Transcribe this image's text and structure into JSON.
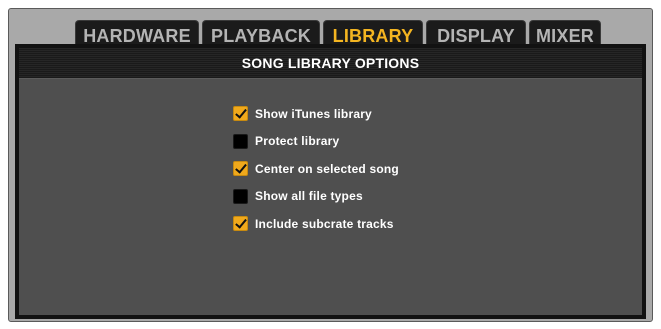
{
  "tabs": [
    {
      "label": "HARDWARE",
      "active": false
    },
    {
      "label": "PLAYBACK",
      "active": false
    },
    {
      "label": "LIBRARY",
      "active": true
    },
    {
      "label": "DISPLAY",
      "active": false
    },
    {
      "label": "MIXER",
      "active": false
    }
  ],
  "panel": {
    "title": "SONG LIBRARY OPTIONS",
    "options": [
      {
        "label": "Show iTunes library",
        "checked": true
      },
      {
        "label": "Protect library",
        "checked": false
      },
      {
        "label": "Center on selected song",
        "checked": true
      },
      {
        "label": "Show all file types",
        "checked": false
      },
      {
        "label": "Include subcrate tracks",
        "checked": true
      }
    ]
  },
  "colors": {
    "accent": "#f4b521",
    "checkbox_checked": "#f0a91c",
    "panel_bg": "#4f4f4f",
    "frame_bg": "#a9a9a9"
  }
}
